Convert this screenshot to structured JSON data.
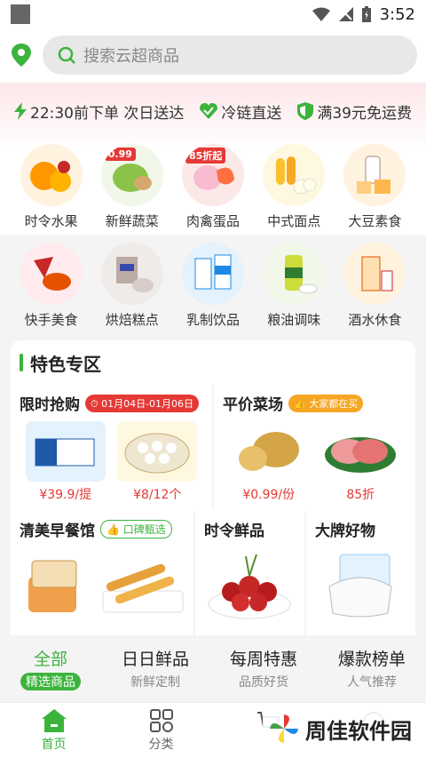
{
  "status": {
    "time": "3:52"
  },
  "search": {
    "placeholder": "搜索云超商品"
  },
  "perks": [
    {
      "label": "22:30前下单 次日送达"
    },
    {
      "label": "冷链直送"
    },
    {
      "label": "满39元免运费"
    }
  ],
  "categories": [
    {
      "label": "时令水果",
      "color": "#ffb74d"
    },
    {
      "label": "新鲜蔬菜",
      "color": "#a5d6a7",
      "tag": "0.99"
    },
    {
      "label": "肉禽蛋品",
      "color": "#ffccbc",
      "tag": "85折起"
    },
    {
      "label": "中式面点",
      "color": "#ffe082"
    },
    {
      "label": "大豆素食",
      "color": "#ffe0b2"
    },
    {
      "label": "快手美食",
      "color": "#ef9a9a"
    },
    {
      "label": "烘焙糕点",
      "color": "#d7ccc8"
    },
    {
      "label": "乳制饮品",
      "color": "#bbdefb"
    },
    {
      "label": "粮油调味",
      "color": "#c5e1a5"
    },
    {
      "label": "酒水休食",
      "color": "#ffcc80"
    }
  ],
  "special": {
    "title": "特色专区",
    "flash": {
      "title": "限时抢购",
      "badge": "01月04日-01月06日",
      "items": [
        {
          "price": "¥39.9/提"
        },
        {
          "price": "¥8/12个"
        }
      ]
    },
    "cheap": {
      "title": "平价菜场",
      "badge": "大家都在买",
      "items": [
        {
          "price": "¥0.99/份"
        },
        {
          "price": "85折"
        }
      ]
    },
    "breakfast": {
      "title": "清美早餐馆",
      "badge": "口碑甄选"
    },
    "fresh": {
      "title": "时令鲜品"
    },
    "brand": {
      "title": "大牌好物"
    }
  },
  "tabs": [
    {
      "title": "全部",
      "sub": "精选商品"
    },
    {
      "title": "日日鲜品",
      "sub": "新鲜定制"
    },
    {
      "title": "每周特惠",
      "sub": "品质好货"
    },
    {
      "title": "爆款榜单",
      "sub": "人气推荐"
    }
  ],
  "nav": [
    {
      "label": "首页"
    },
    {
      "label": "分类"
    }
  ],
  "watermark": "周佳软件园",
  "colors": {
    "accent": "#3cb43c",
    "price": "#e53935"
  }
}
